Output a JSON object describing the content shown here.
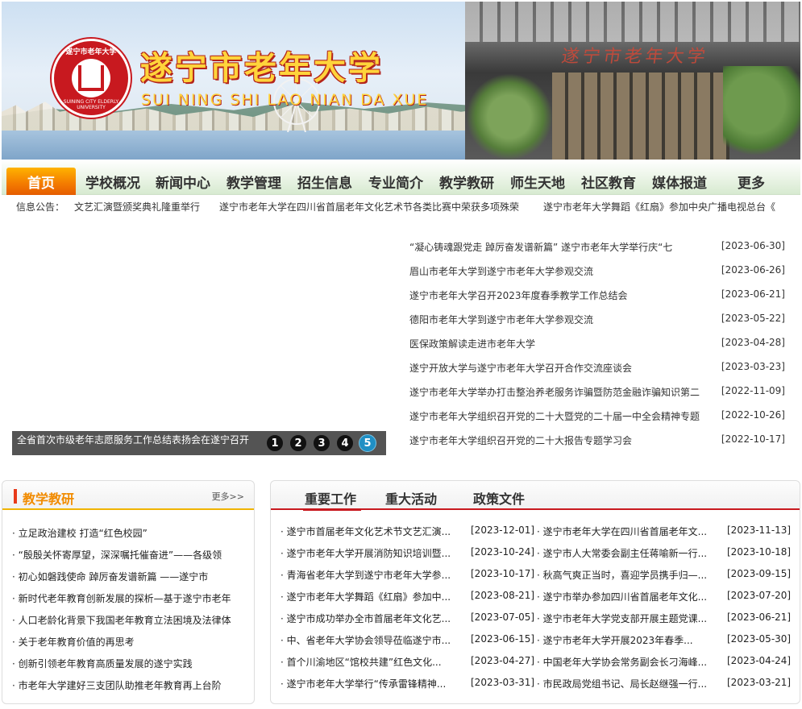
{
  "header": {
    "logo_ring_text": "遂宁市老年大学",
    "logo_ring_sub": "SUINING CITY ELDERLY UNIVERSITY",
    "title": "遂宁市老年大学",
    "subtitle": "SUI NING SHI LAO NIAN DA XUE",
    "building_sign": "遂宁市老年大学"
  },
  "nav": [
    {
      "label": "首页"
    },
    {
      "label": "学校概况"
    },
    {
      "label": "新闻中心"
    },
    {
      "label": "教学管理"
    },
    {
      "label": "招生信息"
    },
    {
      "label": "专业简介"
    },
    {
      "label": "教学教研"
    },
    {
      "label": "师生天地"
    },
    {
      "label": "社区教育"
    },
    {
      "label": "媒体报道"
    },
    {
      "label": "更多"
    }
  ],
  "notice": {
    "label": "信息公告：",
    "items": [
      "文艺汇演暨颁奖典礼隆重举行",
      "遂宁市老年大学在四川省首届老年文化艺术节各类比赛中荣获多项殊荣",
      "遂宁市老年大学舞蹈《红扇》参加中央广播电视总台《"
    ]
  },
  "slider": {
    "caption": "全省首次市级老年志愿服务工作总结表扬会在遂宁召开",
    "dots": [
      "1",
      "2",
      "3",
      "4",
      "5"
    ],
    "active": "5"
  },
  "news": [
    {
      "title": "“凝心铸魂跟党走 踔厉奋发谱新篇” 遂宁市老年大学举行庆“七",
      "date": "[2023-06-30]"
    },
    {
      "title": "眉山市老年大学到遂宁市老年大学参观交流",
      "date": "[2023-06-26]"
    },
    {
      "title": "遂宁市老年大学召开2023年度春季教学工作总结会",
      "date": "[2023-06-21]"
    },
    {
      "title": "德阳市老年大学到遂宁市老年大学参观交流",
      "date": "[2023-05-22]"
    },
    {
      "title": "医保政策解读走进市老年大学",
      "date": "[2023-04-28]"
    },
    {
      "title": "遂宁开放大学与遂宁市老年大学召开合作交流座谈会",
      "date": "[2023-03-23]"
    },
    {
      "title": "遂宁市老年大学举办打击整治养老服务诈骗暨防范金融诈骗知识第二",
      "date": "[2022-11-09]"
    },
    {
      "title": "遂宁市老年大学组织召开党的二十大暨党的二十届一中全会精神专题",
      "date": "[2022-10-26]"
    },
    {
      "title": "遂宁市老年大学组织召开党的二十大报告专题学习会",
      "date": "[2022-10-17]"
    }
  ],
  "teaching": {
    "title": "教学教研",
    "more": "更多>>",
    "items": [
      "· 立足政治建校 打造“红色校园”",
      "· “殷殷关怀寄厚望，深深嘱托催奋进”——各级领",
      "· 初心如磐践使命 踔厉奋发谱新篇 ——遂宁市",
      "· 新时代老年教育创新发展的探析—基于遂宁市老年",
      "· 人口老龄化背景下我国老年教育立法困境及法律体",
      "· 关于老年教育价值的再思考",
      "· 创新引领老年教育高质量发展的遂宁实践",
      "· 市老年大学建好三支团队助推老年教育再上台阶"
    ]
  },
  "work": {
    "tabs": [
      "重要工作",
      "重大活动",
      "政策文件"
    ],
    "left": [
      {
        "title": "· 遂宁市首届老年文化艺术节文艺汇演...",
        "date": "[2023-12-01]"
      },
      {
        "title": "· 遂宁市老年大学开展消防知识培训暨...",
        "date": "[2023-10-24]"
      },
      {
        "title": "· 青海省老年大学到遂宁市老年大学参...",
        "date": "[2023-10-17]"
      },
      {
        "title": "· 遂宁市老年大学舞蹈《红扇》参加中...",
        "date": "[2023-08-21]"
      },
      {
        "title": "· 遂宁市成功举办全市首届老年文化艺...",
        "date": "[2023-07-05]"
      },
      {
        "title": "· 中、省老年大学协会领导莅临遂宁市...",
        "date": "[2023-06-15]"
      },
      {
        "title": "· 首个川渝地区“馆校共建”红色文化...",
        "date": "[2023-04-27]"
      },
      {
        "title": "· 遂宁市老年大学举行“传承雷锋精神...",
        "date": "[2023-03-31]"
      }
    ],
    "right": [
      {
        "title": "· 遂宁市老年大学在四川省首届老年文...",
        "date": "[2023-11-13]"
      },
      {
        "title": "· 遂宁市人大常委会副主任蒋喻新一行...",
        "date": "[2023-10-18]"
      },
      {
        "title": "· 秋高气爽正当时，喜迎学员携手归—...",
        "date": "[2023-09-15]"
      },
      {
        "title": "· 遂宁市举办参加四川省首届老年文化...",
        "date": "[2023-07-20]"
      },
      {
        "title": "· 遂宁市老年大学党支部开展主题党课...",
        "date": "[2023-06-21]"
      },
      {
        "title": "· 遂宁市老年大学开展2023年春季...",
        "date": "[2023-05-30]"
      },
      {
        "title": "· 中国老年大学协会常务副会长刁海峰...",
        "date": "[2023-04-24]"
      },
      {
        "title": "· 市民政局党组书记、局长赵继强一行...",
        "date": "[2023-03-21]"
      }
    ]
  }
}
